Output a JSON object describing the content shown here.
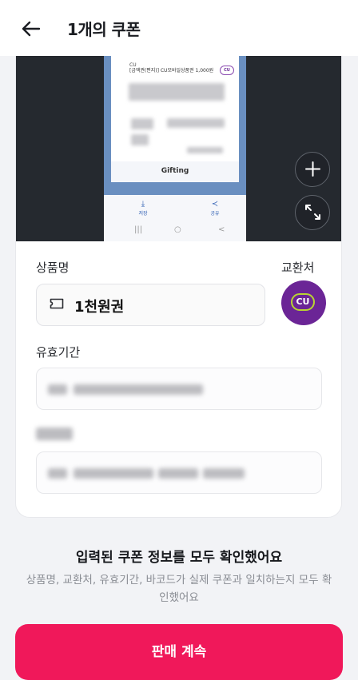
{
  "header": {
    "title": "1개의 쿠폰"
  },
  "preview": {
    "brand_small": "CU",
    "coupon_title_small": "[금액권(편지)] CU모바일상품권 1,000원",
    "badge_small": "CU",
    "gifting_label": "Gifting",
    "save_label": "저장",
    "share_label": "공유",
    "nav": [
      "|||",
      "○",
      "<"
    ]
  },
  "form": {
    "product_label": "상품명",
    "product_value": "1천원권",
    "exchange_label": "교환처",
    "exchange_logo_text": "CU",
    "validity_label": "유효기간"
  },
  "confirm": {
    "title": "입력된 쿠폰 정보를 모두 확인했어요",
    "desc": "상품명, 교환처, 유효기간, 바코드가 실제 쿠폰과 일치하는지 모두 확인했어요"
  },
  "cta": {
    "label": "판매 계속"
  }
}
